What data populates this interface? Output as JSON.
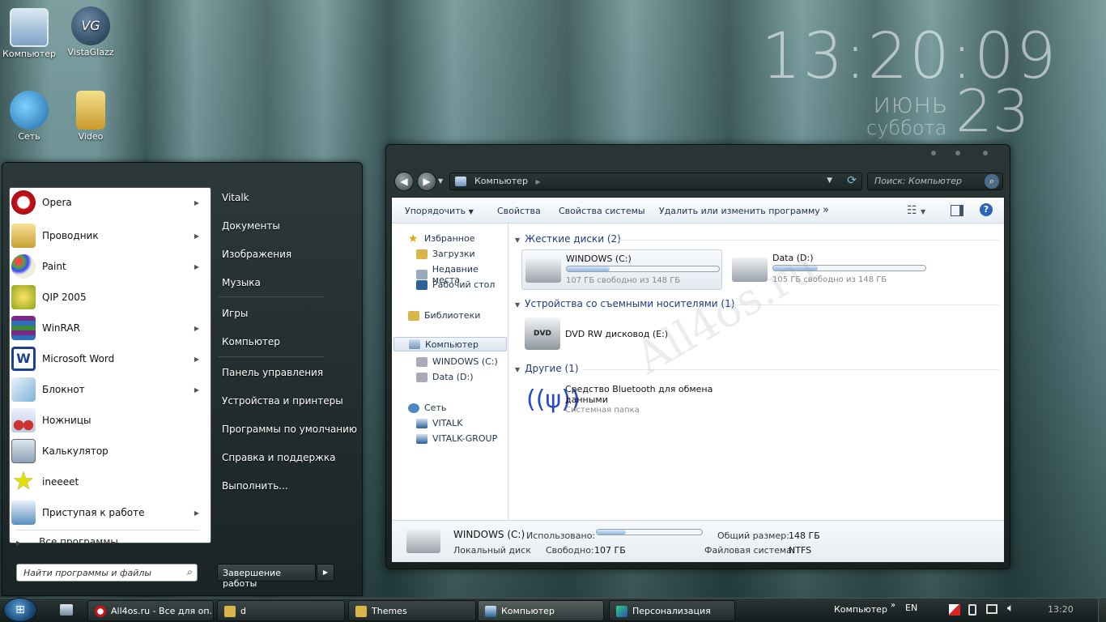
{
  "desktop": {
    "icons": [
      {
        "label": "Компьютер"
      },
      {
        "label": "VistaGlazz"
      },
      {
        "label": "Сеть"
      },
      {
        "label": "Video"
      }
    ]
  },
  "clock": {
    "time": "13:20:09",
    "month": "июнь",
    "weekday": "суббота",
    "day": "23"
  },
  "watermark": "All4os.ru",
  "start_menu": {
    "programs": [
      {
        "label": "Opera",
        "has_arrow": true
      },
      {
        "label": "Проводник",
        "has_arrow": true
      },
      {
        "label": "Paint",
        "has_arrow": true
      },
      {
        "label": "QIP 2005",
        "has_arrow": false
      },
      {
        "label": "WinRAR",
        "has_arrow": true
      },
      {
        "label": "Microsoft Word",
        "has_arrow": true
      },
      {
        "label": "Блокнот",
        "has_arrow": true
      },
      {
        "label": "Ножницы",
        "has_arrow": false
      },
      {
        "label": "Калькулятор",
        "has_arrow": false
      },
      {
        "label": "ineeeet",
        "has_arrow": false
      },
      {
        "label": "Приступая к работе",
        "has_arrow": true
      }
    ],
    "all_programs": "Все программы",
    "search_placeholder": "Найти программы и файлы",
    "right_links": [
      "Vitalk",
      "Документы",
      "Изображения",
      "Музыка",
      "Игры",
      "Компьютер",
      "Панель управления",
      "Устройства и принтеры",
      "Программы по умолчанию",
      "Справка и поддержка",
      "Выполнить..."
    ],
    "shutdown": "Завершение работы"
  },
  "explorer": {
    "address": "Компьютер",
    "search_placeholder": "Поиск: Компьютер",
    "toolbar": [
      "Упорядочить",
      "Свойства",
      "Свойства системы",
      "Удалить или изменить программу",
      "»"
    ],
    "nav": {
      "favorites": "Избранное",
      "downloads": "Загрузки",
      "recent": "Недавние места",
      "desktop": "Рабочий стол",
      "libraries": "Библиотеки",
      "computer": "Компьютер",
      "drive_c": "WINDOWS (C:)",
      "drive_d": "Data (D:)",
      "network": "Сеть",
      "net1": "VITALK",
      "net2": "VITALK-GROUP"
    },
    "groups": {
      "hdd": "Жесткие диски (2)",
      "removable": "Устройства со съемными носителями (1)",
      "other": "Другие (1)"
    },
    "drives": [
      {
        "name": "WINDOWS (C:)",
        "free": "107 ГБ свободно из 148 ГБ",
        "used_fraction": 0.28
      },
      {
        "name": "Data (D:)",
        "free": "105 ГБ свободно из 148 ГБ",
        "used_fraction": 0.29
      }
    ],
    "dvd": {
      "name": "DVD RW дисковод (E:)",
      "badge": "DVD"
    },
    "bluetooth": {
      "name_line1": "Средство Bluetooth для обмена",
      "name_line2": "данными",
      "type": "Системная папка"
    },
    "status": {
      "name": "WINDOWS (C:)",
      "type": "Локальный диск",
      "used_label": "Использовано:",
      "free_label": "Свободно:",
      "free_value": "107 ГБ",
      "total_label": "Общий размер:",
      "total_value": "148 ГБ",
      "fs_label": "Файловая система:",
      "fs_value": "NTFS",
      "used_fraction": 0.28
    }
  },
  "taskbar": {
    "buttons": [
      {
        "label": "All4os.ru - Все для оп..."
      },
      {
        "label": "d"
      },
      {
        "label": "Themes"
      },
      {
        "label": "Компьютер"
      },
      {
        "label": "Персонализация"
      }
    ],
    "toolbar_label": "Компьютер",
    "lang": "EN",
    "time": "13:20"
  }
}
